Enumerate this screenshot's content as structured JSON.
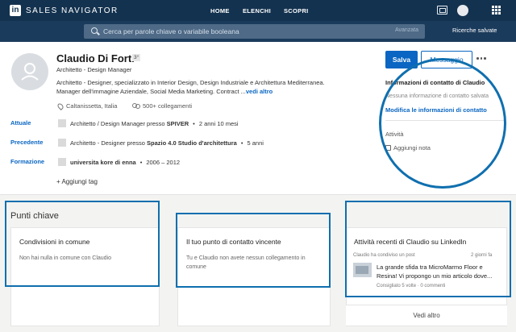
{
  "topnav": {
    "logo_text": "in",
    "brand": "SALES NAVIGATOR",
    "items": [
      "HOME",
      "ELENCHI",
      "SCOPRI"
    ]
  },
  "search": {
    "placeholder": "Cerca per parole chiave o variabile booleana",
    "advanced_label": "Avanzata",
    "saved_label": "Ricerche salvate"
  },
  "profile": {
    "name": "Claudio Di Forti",
    "degree": "3°",
    "headline": "Architetto - Design Manager",
    "summary": "Architetto - Designer, specializzato in Interior Design, Design Industriale e Architettura Mediterranea. Manager dell'immagine Aziendale, Social Media Marketing. Contract ...",
    "see_more": "vedi altro",
    "location": "Caltanissetta, Italia",
    "connections": "500+ collegamenti",
    "current_label": "Attuale",
    "current_text": "Architetto / Design Manager presso ",
    "current_company": "SPIVER",
    "current_duration": "2 anni 10 mesi",
    "previous_label": "Precedente",
    "previous_text": "Architetto - Designer presso ",
    "previous_company": "Spazio 4.0 Studio d'architettura",
    "previous_duration": "5 anni",
    "education_label": "Formazione",
    "education_school": "universita kore di enna",
    "education_years": "2006 – 2012",
    "add_tag": "Aggiungi tag"
  },
  "actions": {
    "save": "Salva",
    "message": "Messaggio"
  },
  "contact": {
    "title": "Informazioni di contatto di Claudio",
    "none": "Nessuna informazione di contatto salvata",
    "edit": "Modifica le informazioni di contatto",
    "activity": "Attività",
    "add_note": "Aggiungi nota"
  },
  "key_points": {
    "title": "Punti chiave",
    "cards": [
      {
        "title": "Condivisioni in comune",
        "body": "Non hai nulla in comune con Claudio"
      },
      {
        "title": "Il tuo punto di contatto vincente",
        "body": "Tu e Claudio non avete nessun collegamento in comune"
      },
      {
        "title": "Attività recenti di Claudio su LinkedIn"
      }
    ],
    "activity": {
      "meta": "Claudio ha condiviso un post",
      "time": "2 giorni fa",
      "text": "La grande sfida tra MicroMarmo Floor e Resina! Vi propongo un mio articolo dove...",
      "stats": "Consigliato 5 volte · 0 commenti",
      "see_more": "Vedi altro"
    }
  },
  "colors": {
    "nav_bg": "#13324f",
    "accent": "#0a66c2",
    "highlight": "#0f6faf"
  }
}
